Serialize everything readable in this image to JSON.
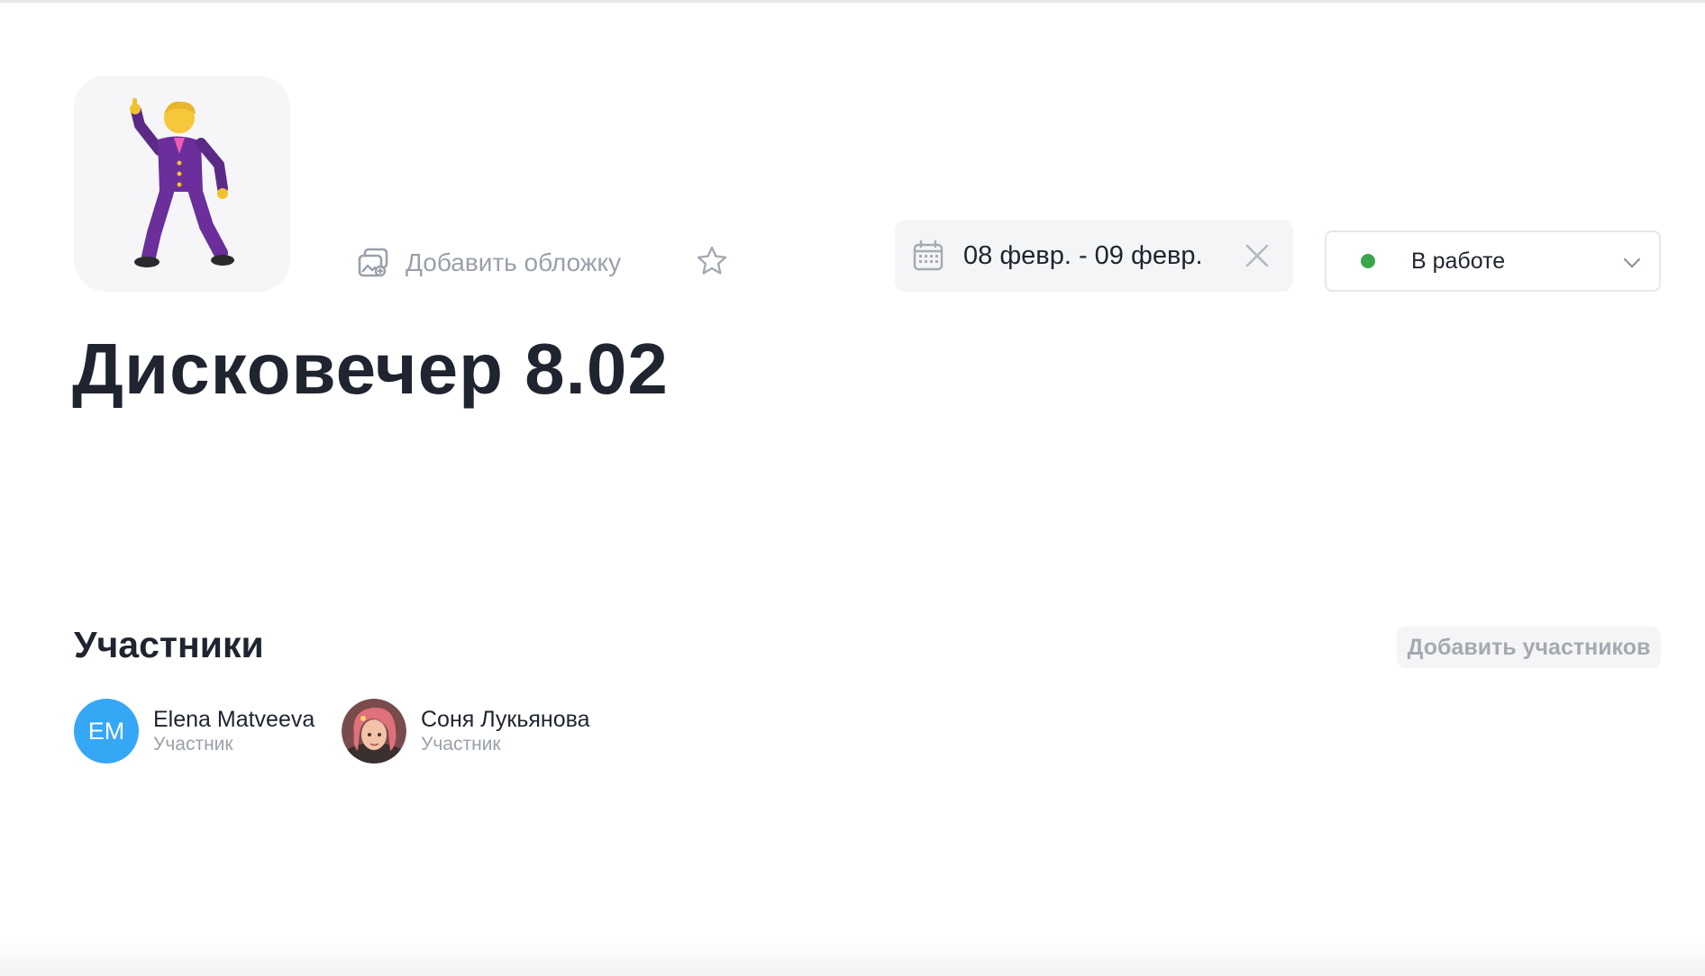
{
  "project": {
    "icon": "man-dancing-emoji",
    "title": "Дисковечер 8.02",
    "add_cover_label": "Добавить обложку",
    "add_cover_icon": "image-add-icon",
    "favorite_icon": "star-outline-icon"
  },
  "date_range": {
    "icon": "calendar-icon",
    "text": "08 февр. - 09 февр.",
    "clear_icon": "close-icon"
  },
  "status": {
    "label": "В работе",
    "dot_color": "#3aa64c",
    "chevron_icon": "chevron-down-icon"
  },
  "members": {
    "heading": "Участники",
    "add_button_label": "Добавить участников",
    "items": [
      {
        "initials": "EM",
        "name": "Elena Matveeva",
        "role": "Участник",
        "avatar_color": "#35a7f5"
      },
      {
        "initials": "",
        "name": "Соня Лукьянова",
        "role": "Участник",
        "avatar_icon": "user-photo-avatar"
      }
    ]
  }
}
